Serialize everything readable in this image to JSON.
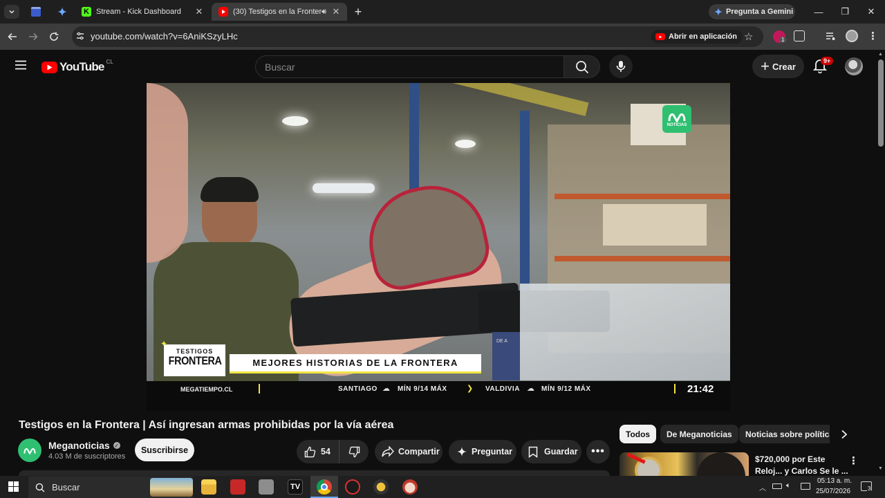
{
  "browser": {
    "tabs": [
      {
        "title": ""
      },
      {
        "title": ""
      },
      {
        "title": "Stream - Kick Dashboard"
      },
      {
        "title": "(30) Testigos en la Frontera"
      }
    ],
    "gemini_label": "Pregunta a Gemini",
    "url": "youtube.com/watch?v=6AniKSzyLHc",
    "open_app_label": "Abrir en aplicación",
    "extension_badge": "1"
  },
  "youtube": {
    "logo_text": "YouTube",
    "country": "CL",
    "search_placeholder": "Buscar",
    "create_label": "Crear",
    "notif_badge": "9+"
  },
  "video": {
    "logo_label": "NOTICIAS",
    "lower_third_logo_top": "TESTIGOS",
    "lower_third_logo_main": "FRONTERA",
    "lower_third_text": "MEJORES HISTORIAS DE LA FRONTERA",
    "ticker": {
      "site": "MEGATIEMPO.CL",
      "city1": "SANTIAGO",
      "city1_temp": "MÍN 9/14 MÁX",
      "city2": "VALDIVIA",
      "city2_temp": "MÍN 9/12 MÁX",
      "time": "21:42"
    },
    "box_text": "DE A"
  },
  "details": {
    "title": "Testigos en la Frontera | Así ingresan armas prohibidas por la vía aérea",
    "channel_name": "Meganoticias",
    "subscribers": "4.03 M de suscriptores",
    "subscribe_label": "Suscribirse",
    "likes": "54",
    "share_label": "Compartir",
    "ask_label": "Preguntar",
    "save_label": "Guardar"
  },
  "chips": [
    "Todos",
    "De Meganoticias",
    "Noticias sobre política"
  ],
  "recommendation": {
    "title_line1": "$720,000 por Este",
    "title_line2": "Reloj... y Carlos Se le ..."
  },
  "taskbar": {
    "search_label": "Buscar",
    "time": "05:13 a. m.",
    "date": "25/07/2026",
    "notif_count": "3"
  },
  "colors": {
    "yt_red": "#ff0000",
    "kick_green": "#53fc18",
    "megan_green": "#2fbf71"
  }
}
